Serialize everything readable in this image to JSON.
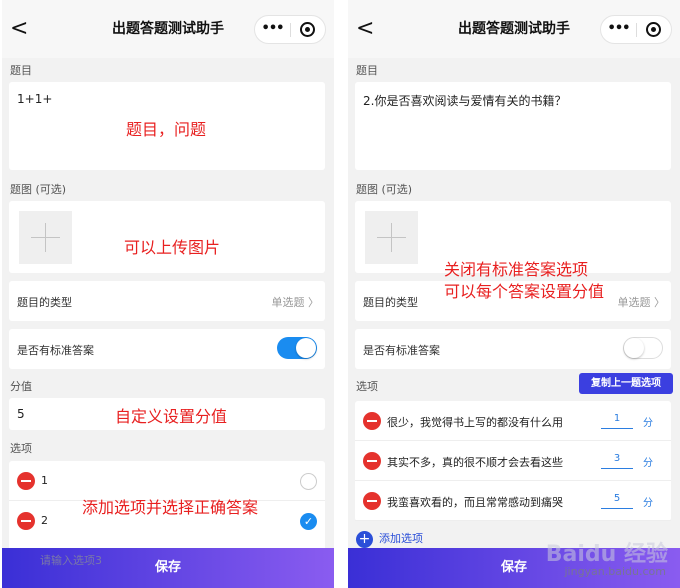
{
  "common": {
    "title": "出题答题测试助手",
    "back_glyph": "<",
    "capsule_dots": "•••",
    "save_label": "保存"
  },
  "left": {
    "question_label": "题目",
    "question_value": "1+1+",
    "image_label": "题图 (可选)",
    "type_label": "题目的类型",
    "type_value": "单选题",
    "std_answer_label": "是否有标准答案",
    "std_answer_on": true,
    "score_label": "分值",
    "score_value": "5",
    "options_label": "选项",
    "options": [
      {
        "text": "1",
        "checked": false
      },
      {
        "text": "2",
        "checked": true
      }
    ],
    "new_option_placeholder": "请输入选项3",
    "annotations": {
      "question": "题目，问题",
      "image": "可以上传图片",
      "score": "自定义设置分值",
      "options": "添加选项并选择正确答案"
    }
  },
  "right": {
    "question_label": "题目",
    "question_value": "2.你是否喜欢阅读与爱情有关的书籍？",
    "image_label": "题图 (可选)",
    "type_label": "题目的类型",
    "type_value": "单选题",
    "std_answer_label": "是否有标准答案",
    "std_answer_on": false,
    "options_label": "选项",
    "copy_button": "复制上一题选项",
    "options": [
      {
        "text": "很少，我觉得书上写的都没有什么用",
        "score": "1",
        "unit": "分"
      },
      {
        "text": "其实不多，真的很不顺才会去看这些",
        "score": "3",
        "unit": "分"
      },
      {
        "text": "我蛮喜欢看的，而且常常感动到痛哭",
        "score": "5",
        "unit": "分"
      }
    ],
    "add_option": "添加选项",
    "add_icon": "+",
    "annotations": {
      "line1": "关闭有标准答案选项",
      "line2": "可以每个答案设置分值"
    },
    "watermark": "Baidu 经验",
    "watermark_url": "jingyan.baidu.com"
  }
}
